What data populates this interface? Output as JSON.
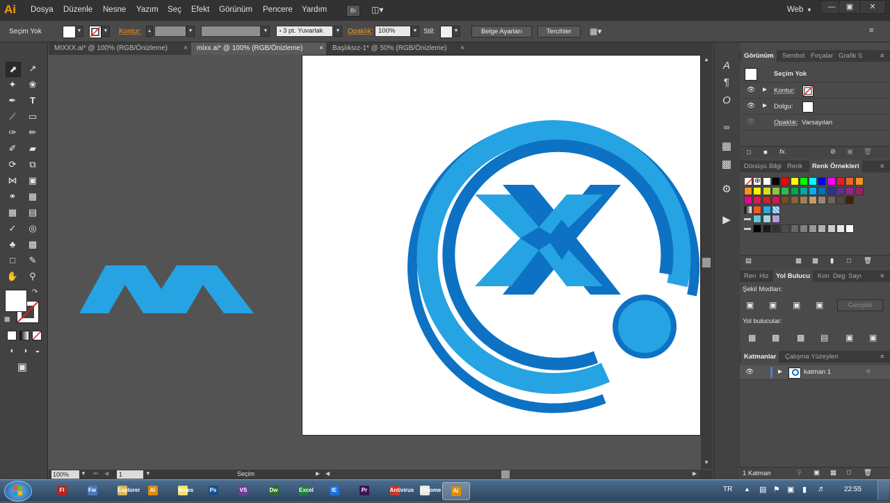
{
  "app": {
    "logo": "Ai",
    "menu": [
      "Dosya",
      "Düzenle",
      "Nesne",
      "Yazım",
      "Seç",
      "Efekt",
      "Görünüm",
      "Pencere",
      "Yardım"
    ],
    "bridge_label": "Br",
    "workspace": "Web",
    "window_buttons": [
      "—",
      "▣",
      "✕"
    ]
  },
  "control_bar": {
    "selection_status": "Seçim Yok",
    "stroke_label": "Kontur:",
    "brush_value": "3 pt. Yuvarlak",
    "opacity_label": "Opaklık:",
    "opacity_value": "100%",
    "style_label": "Stil:",
    "doc_settings_button": "Belge Ayarları",
    "prefs_button": "Tercihler"
  },
  "tabs": [
    {
      "label": "MIXXX.ai* @ 100% (RGB/Önizleme)",
      "active": false
    },
    {
      "label": "mixx.ai* @ 100% (RGB/Önizleme)",
      "active": true
    },
    {
      "label": "Başlıksız-1* @ 50% (RGB/Önizleme)",
      "active": false
    }
  ],
  "tab_close": "×",
  "status_bar": {
    "zoom": "100%",
    "page": "1",
    "tool": "Seçim"
  },
  "appearance_panel": {
    "tabs": [
      "Görünüm",
      "Sembol",
      "Fırçalar",
      "Grafik S"
    ],
    "title": "Seçim Yok",
    "stroke_label": "Kontur:",
    "fill_label": "Dolgu:",
    "opacity_label": "Opaklık:",
    "opacity_value": "Varsayılan",
    "fx_label": "fx."
  },
  "swatches_panel": {
    "tabs": [
      "Dönüşü",
      "Bilgi",
      "Renk",
      "Renk Örnekleri"
    ]
  },
  "pathfinder_panel": {
    "tabs": [
      "Ren",
      "Hiz",
      "Yol Bulucu",
      "Kon",
      "Deg",
      "Sayı"
    ],
    "shape_modes_label": "Şekil Modları:",
    "expand_button": "Genişlet",
    "pathfinders_label": "Yol bulucular:"
  },
  "layers_panel": {
    "tabs": [
      "Katmanlar",
      "Çalışma Yüzeyleri"
    ],
    "layer_name": "katman 1",
    "footer_count": "1 Katman"
  },
  "taskbar": {
    "language": "TR",
    "clock": "22:55",
    "apps": [
      "Fl",
      "Fw",
      "Explorer",
      "Ai",
      "Notes",
      "Ps",
      "VS",
      "Dw",
      "Excel",
      "IE",
      "Pr",
      "Antivirus",
      "Chrome",
      "Ai"
    ]
  },
  "colors": {
    "logo_dark_blue": "#0d72c4",
    "logo_light_blue": "#26a3e3",
    "accent_orange": "#f29a2e"
  }
}
